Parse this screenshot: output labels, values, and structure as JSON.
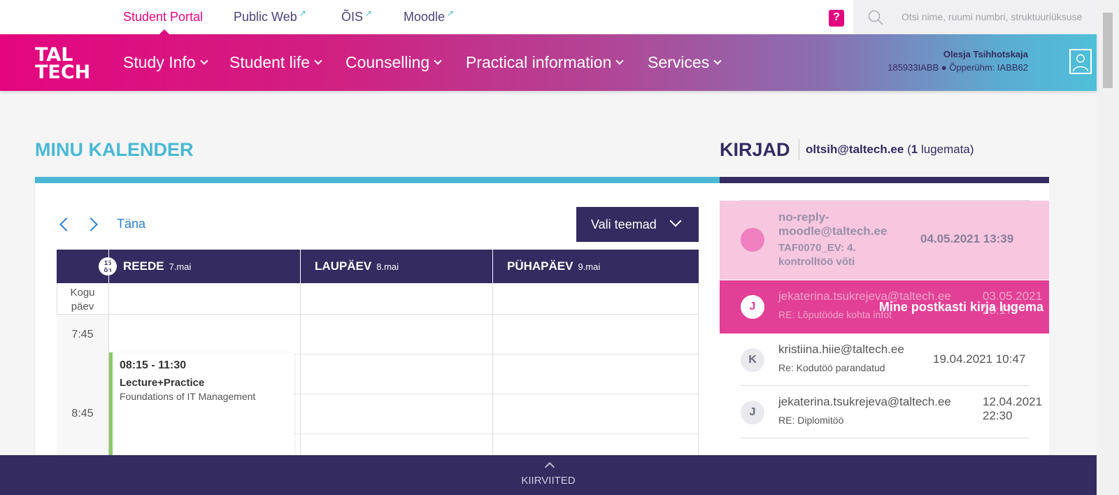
{
  "topnav": {
    "items": [
      {
        "label": "Student Portal",
        "active": true
      },
      {
        "label": "Public Web",
        "external": true
      },
      {
        "label": "ÕIS",
        "external": true
      },
      {
        "label": "Moodle",
        "external": true
      }
    ],
    "help_icon": "?",
    "search_placeholder": "Otsi nime, ruumi numbri, struktuuriüksuse"
  },
  "navbar": {
    "logo_line1": "TAL",
    "logo_line2": "TECH",
    "items": [
      "Study Info",
      "Student life",
      "Counselling",
      "Practical information",
      "Services"
    ],
    "user_name": "Olesja Tsihhotskaja",
    "user_info": "185933IABB ● Õpperühm: IABB62"
  },
  "calendar": {
    "title": "MINU KALENDER",
    "today_label": "Täna",
    "topics_button": "Vali teemad",
    "week_badge_num": "15",
    "week_badge_label": "õn",
    "days": [
      {
        "name": "REEDE",
        "date": "7.mai"
      },
      {
        "name": "LAUPÄEV",
        "date": "8.mai"
      },
      {
        "name": "PÜHAPÄEV",
        "date": "9.mai"
      }
    ],
    "allday_label_line1": "Kogu",
    "allday_label_line2": "päev",
    "times": [
      "7:45",
      "8:45"
    ],
    "event": {
      "time": "08:15 - 11:30",
      "type": "Lecture+Practice",
      "name": "Foundations of IT Management"
    }
  },
  "mail": {
    "title": "KIRJAD",
    "account": "oltsih@taltech.ee",
    "unread_count": "1",
    "unread_label": "lugemata)",
    "open_paren": "(",
    "go_inbox": "Mine postkasti kirja lugema",
    "items": [
      {
        "from": "no-reply-moodle@taltech.ee",
        "subject": "TAF0070_EV: 4. kontrolltöö võti",
        "date": "04.05.2021 13:39",
        "avatar": ""
      },
      {
        "from": "jekaterina.tsukrejeva@taltech.ee",
        "subject": "RE: Lõputööde kohta infot",
        "date": "03.05.2021 23:17",
        "avatar": "J"
      },
      {
        "from": "kristiina.hiie@taltech.ee",
        "subject": "Re: Kodutöö parandatud",
        "date": "19.04.2021 10:47",
        "avatar": "K"
      },
      {
        "from": "jekaterina.tsukrejeva@taltech.ee",
        "subject": "RE: Diplomitöö",
        "date": "12.04.2021 22:30",
        "avatar": "J"
      }
    ]
  },
  "footer": {
    "label": "KIIRVIITED"
  },
  "colors": {
    "brand_pink": "#e4067e",
    "brand_navy": "#342b60",
    "brand_cyan": "#4ab8d3"
  }
}
